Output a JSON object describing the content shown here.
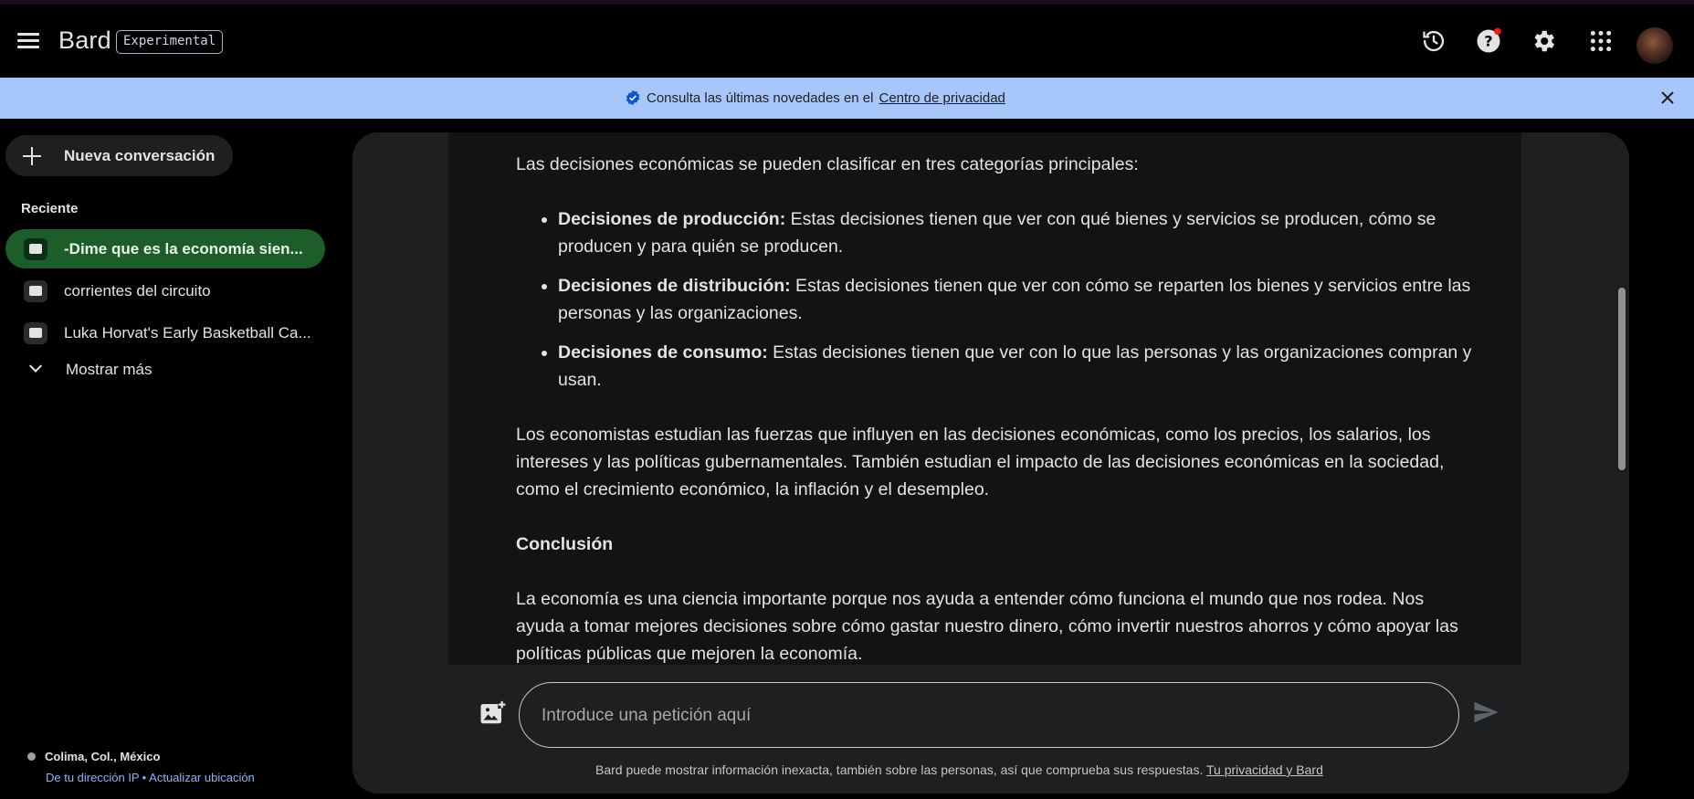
{
  "header": {
    "app_name": "Bard",
    "badge": "Experimental",
    "icons": [
      "menu-icon",
      "history-icon",
      "help-icon",
      "settings-icon",
      "apps-icon",
      "avatar"
    ]
  },
  "banner": {
    "text": "Consulta las últimas novedades en el",
    "link": "Centro de privacidad"
  },
  "sidebar": {
    "new_chat": "Nueva conversación",
    "recent_label": "Reciente",
    "items": [
      {
        "label": "-Dime que es la economía siendo un profesor experto",
        "display": "-Dime que es la economía sien..."
      },
      {
        "label": "corrientes del circuito",
        "display": "corrientes del circuito"
      },
      {
        "label": "Luka Horvat's Early Basketball Career",
        "display": "Luka Horvat's Early Basketball Ca..."
      }
    ],
    "show_more": "Mostrar más",
    "location": {
      "place": "Colima, Col., México",
      "ip_link": "De tu dirección IP",
      "separator": "•",
      "update_link": "Actualizar ubicación"
    }
  },
  "response": {
    "intro": "Las decisiones económicas se pueden clasificar en tres categorías principales:",
    "bullets": [
      {
        "bold": "Decisiones de producción:",
        "text": " Estas decisiones tienen que ver con qué bienes y servicios se producen, cómo se producen y para quién se producen."
      },
      {
        "bold": "Decisiones de distribución:",
        "text": " Estas decisiones tienen que ver con cómo se reparten los bienes y servicios entre las personas y las organizaciones."
      },
      {
        "bold": "Decisiones de consumo:",
        "text": " Estas decisiones tienen que ver con lo que las personas y las organizaciones compran y usan."
      }
    ],
    "paragraph2": "Los economistas estudian las fuerzas que influyen en las decisiones económicas, como los precios, los salarios, los intereses y las políticas gubernamentales. También estudian el impacto de las decisiones económicas en la sociedad, como el crecimiento económico, la inflación y el desempleo.",
    "heading": "Conclusión",
    "paragraph3": "La economía es una ciencia importante porque nos ayuda a entender cómo funciona el mundo que nos rodea. Nos ayuda a tomar mejores decisiones sobre cómo gastar nuestro dinero, cómo invertir nuestros ahorros y cómo apoyar las políticas públicas que mejoren la economía."
  },
  "input": {
    "placeholder": "Introduce una petición aquí",
    "value": ""
  },
  "footer": {
    "disclaimer": "Bard puede mostrar información inexacta, también sobre las personas, así que comprueba sus respuestas.",
    "link": "Tu privacidad y Bard"
  },
  "colors": {
    "banner_bg": "#a7c7fa",
    "active_chat_bg": "#1d5d2a",
    "panel_bg": "#1e1f20",
    "response_bg": "#131314",
    "link_blue": "#8ab4f8",
    "notification_dot": "#f21a1a"
  }
}
